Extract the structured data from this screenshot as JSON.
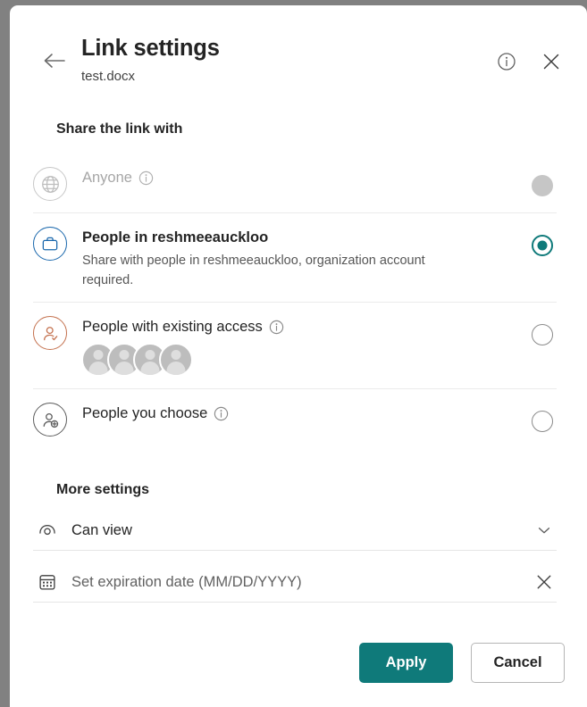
{
  "header": {
    "back_icon": "arrow-left-icon",
    "title": "Link settings",
    "subtitle": "test.docx",
    "info_icon": "info-circle-icon",
    "close_icon": "close-icon"
  },
  "share_section": {
    "heading": "Share the link with",
    "options": [
      {
        "id": "anyone",
        "icon": "globe-icon",
        "title": "Anyone",
        "info_icon": "info-circle-icon",
        "description": "",
        "state": "disabled",
        "selected": false
      },
      {
        "id": "people-in-org",
        "icon": "briefcase-icon",
        "title": "People in reshmeeauckloo",
        "info_icon": "",
        "description": "Share with people in reshmeeauckloo, organization account required.",
        "state": "enabled",
        "selected": true
      },
      {
        "id": "existing-access",
        "icon": "person-check-icon",
        "title": "People with existing access",
        "info_icon": "info-circle-icon",
        "description": "",
        "state": "enabled",
        "selected": false,
        "avatar_count": 4
      },
      {
        "id": "people-you-choose",
        "icon": "person-add-icon",
        "title": "People you choose",
        "info_icon": "info-circle-icon",
        "description": "",
        "state": "enabled",
        "selected": false
      }
    ]
  },
  "more_settings": {
    "heading": "More settings",
    "permission": {
      "icon": "eye-icon",
      "value": "Can view",
      "chevron_icon": "chevron-down-icon"
    },
    "expiration": {
      "icon": "calendar-icon",
      "value": "",
      "placeholder": "Set expiration date (MM/DD/YYYY)",
      "clear_icon": "close-icon"
    }
  },
  "footer": {
    "apply_label": "Apply",
    "cancel_label": "Cancel"
  },
  "colors": {
    "accent_teal": "#0f7a7a",
    "org_blue": "#1967ac",
    "existing_orange": "#c4714e",
    "choose_grey": "#5d5d5d",
    "backdrop_grey": "#818181"
  }
}
